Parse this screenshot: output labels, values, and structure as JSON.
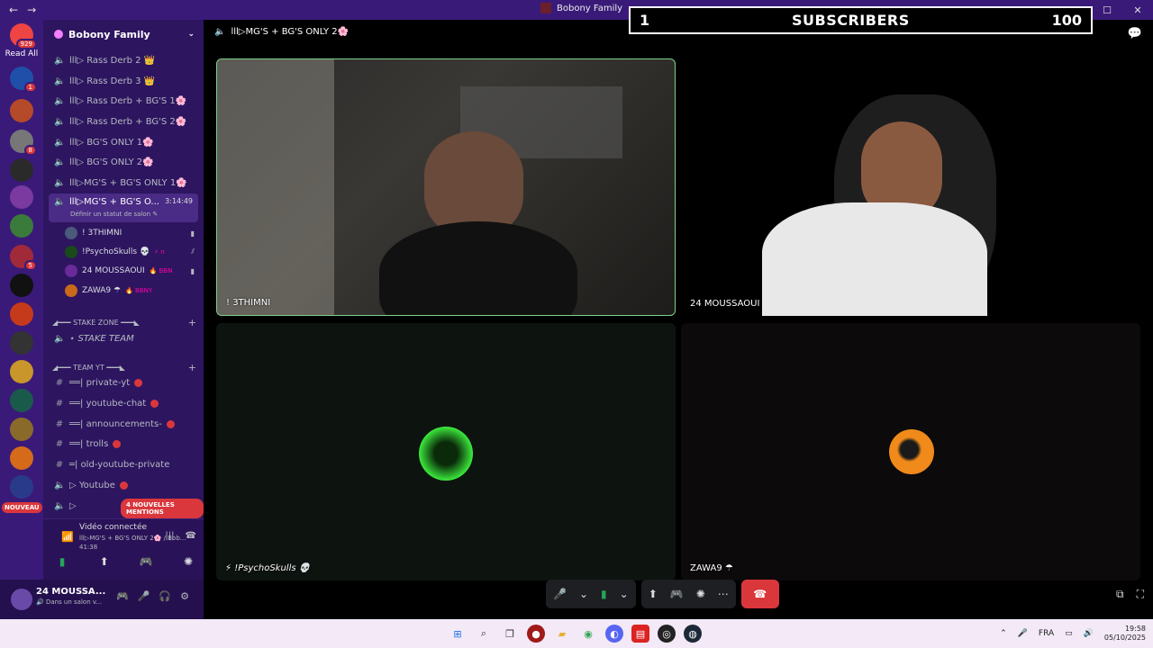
{
  "titlebar": {
    "back": "←",
    "forward": "→",
    "app_title": "Bobony Family",
    "minimize": "—",
    "maximize": "☐",
    "close": "✕"
  },
  "servers": {
    "read_all": "Read All",
    "home_badge": "929",
    "badges": [
      "1",
      "8",
      "5"
    ],
    "nouveau": "NOUVEAU"
  },
  "guild": {
    "name": "Bobony Family"
  },
  "channels": [
    {
      "label": "lll▷ Rass Derb 2 👑"
    },
    {
      "label": "lll▷ Rass Derb 3 👑"
    },
    {
      "label": "lll▷ Rass Derb + BG'S 1🌸"
    },
    {
      "label": "lll▷ Rass Derb + BG'S 2🌸"
    },
    {
      "label": "lll▷ BG'S ONLY 1🌸"
    },
    {
      "label": "lll▷ BG'S ONLY 2🌸"
    },
    {
      "label": "lll▷MG'S + BG'S ONLY 1🌸"
    }
  ],
  "active_channel": {
    "label": "lll▷MG'S + BG'S O...",
    "time": "3:14:49",
    "status": "Définir un statut de salon ✎"
  },
  "voice_users": [
    {
      "name": "! 3THIMNI",
      "tag": ""
    },
    {
      "name": "!PsychoSkulls 💀",
      "tag": "⚡ n"
    },
    {
      "name": "24 MOUSSAOUI",
      "tag": "🔥 BBN"
    },
    {
      "name": "ZAWA9 ☂",
      "tag": "🔥 BBNY"
    }
  ],
  "categories": [
    {
      "label": "◢━━━ STAKE ZONE ━━━◣",
      "channel": "⋆ STAKE TEAM"
    },
    {
      "label": "◢━━━ TEAM YT ━━━◣"
    }
  ],
  "yt_channels": [
    {
      "label": "══| private-yt"
    },
    {
      "label": "══| youtube-chat"
    },
    {
      "label": "══| announcements-"
    },
    {
      "label": "══| trolls"
    },
    {
      "label": "═| old-youtube-private"
    },
    {
      "label": "▷ Youtube"
    },
    {
      "label": "▷"
    }
  ],
  "mentions": "4 NOUVELLES MENTIONS",
  "voice_status": {
    "title": "Vidéo connectée",
    "detail": "lll▷MG'S + BG'S ONLY 2🌸 / Bob...",
    "time": "41:38"
  },
  "panel": {
    "name": "24 MOUSSA...",
    "status": "🔊 Dans un salon v..."
  },
  "stage": {
    "title": "lll▷MG'S + BG'S ONLY 2🌸"
  },
  "subscribers": {
    "left": "1",
    "label": "SUBSCRIBERS",
    "right": "100"
  },
  "tiles": [
    {
      "name": "! 3THIMNI"
    },
    {
      "name": "24 MOUSSAOUI"
    },
    {
      "name": "⚡ !PsychoSkulls 💀"
    },
    {
      "name": "ZAWA9 ☂"
    }
  ],
  "taskbar": {
    "lang": "FRA",
    "time": "19:58",
    "date": "05/10/2025"
  },
  "colors": {
    "accent": "#3a1a78",
    "sidebar": "#2d1560",
    "danger": "#da373c",
    "speaking": "#7fd08a"
  }
}
